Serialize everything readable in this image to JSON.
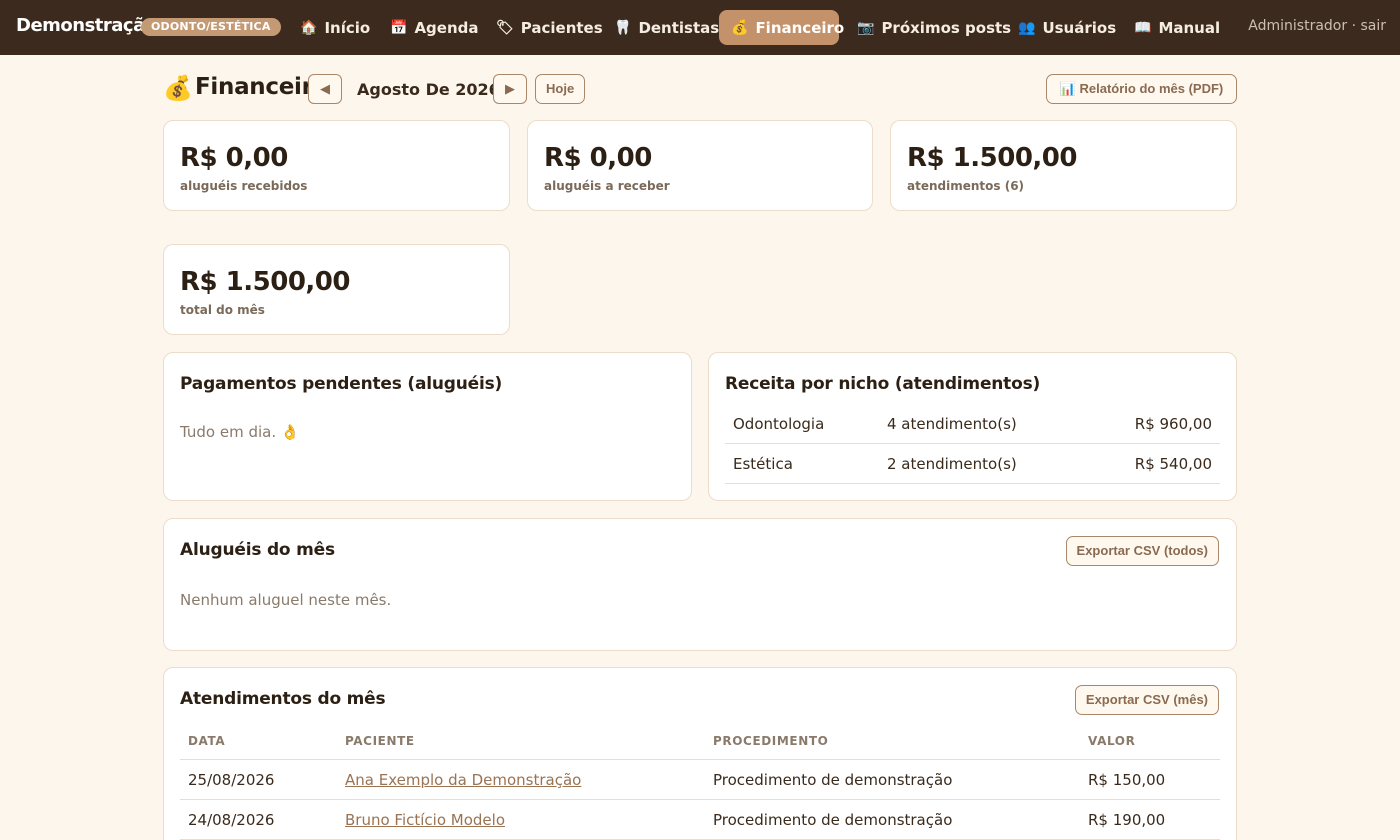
{
  "brand": {
    "name": "Demonstração",
    "badge": "ODONTO/ESTÉTICA"
  },
  "nav": [
    {
      "icon": "🏠",
      "icon_name": "home-icon",
      "label": "Início"
    },
    {
      "icon": "📅",
      "icon_name": "calendar-icon",
      "label": "Agenda"
    },
    {
      "icon": "🏷",
      "icon_name": "tag-icon",
      "label": "Pacientes"
    },
    {
      "icon": "🦷",
      "icon_name": "tooth-icon",
      "label": "Dentistas"
    },
    {
      "icon": "💰",
      "icon_name": "money-bag-icon",
      "label": "Financeiro"
    },
    {
      "icon": "📷",
      "icon_name": "camera-icon",
      "label": "Próximos posts"
    },
    {
      "icon": "👥",
      "icon_name": "users-icon",
      "label": "Usuários"
    },
    {
      "icon": "📖",
      "icon_name": "book-icon",
      "label": "Manual"
    }
  ],
  "active_nav": "Financeiro",
  "user": {
    "text": "Administrador · sair"
  },
  "header": {
    "icon": "💰",
    "title": "Financeiro",
    "prev": "◀",
    "next": "▶",
    "month": "Agosto De 2026",
    "today": "Hoje",
    "report": "📊 Relatório do mês (PDF)"
  },
  "stats": [
    {
      "value": "R$ 0,00",
      "label": "aluguéis recebidos"
    },
    {
      "value": "R$ 0,00",
      "label": "aluguéis a receber"
    },
    {
      "value": "R$ 1.500,00",
      "label": "atendimentos (6)"
    },
    {
      "value": "R$ 1.500,00",
      "label": "total do mês"
    }
  ],
  "pending": {
    "title": "Pagamentos pendentes (aluguéis)",
    "message": "Tudo em dia. 👌"
  },
  "niche": {
    "title": "Receita por nicho (atendimentos)",
    "rows": [
      {
        "name": "Odontologia",
        "count": "4 atendimento(s)",
        "amount": "R$ 960,00"
      },
      {
        "name": "Estética",
        "count": "2 atendimento(s)",
        "amount": "R$ 540,00"
      }
    ]
  },
  "rentals": {
    "title": "Aluguéis do mês",
    "export": "Exportar CSV (todos)",
    "empty": "Nenhum aluguel neste mês."
  },
  "appointments": {
    "title": "Atendimentos do mês",
    "export": "Exportar CSV (mês)",
    "columns": [
      "DATA",
      "PACIENTE",
      "PROCEDIMENTO",
      "VALOR"
    ],
    "rows": [
      {
        "date": "25/08/2026",
        "patient": "Ana Exemplo da Demonstração",
        "procedure": "Procedimento de demonstração",
        "value": "R$ 150,00"
      },
      {
        "date": "24/08/2026",
        "patient": "Bruno Fictício Modelo",
        "procedure": "Procedimento de demonstração",
        "value": "R$ 190,00"
      }
    ]
  },
  "colors": {
    "topbar": "#3b2a1d",
    "accent": "#c4926a",
    "background": "#fdf6ec"
  }
}
